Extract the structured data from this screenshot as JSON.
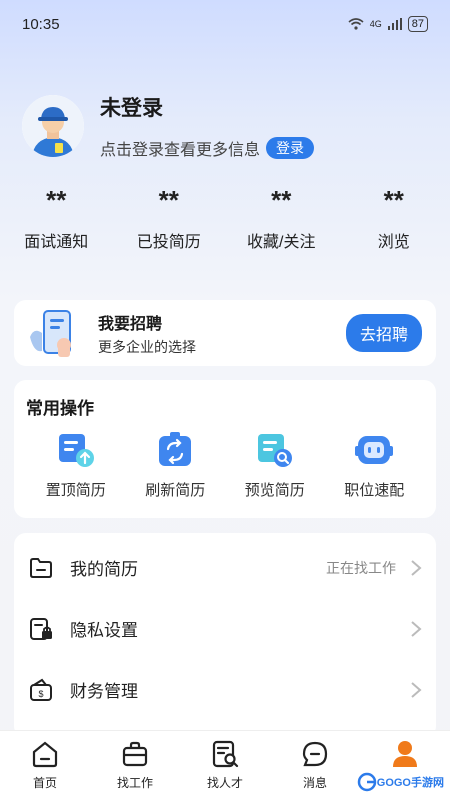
{
  "status": {
    "time": "10:35",
    "network": "4G",
    "battery": "87"
  },
  "profile": {
    "name": "未登录",
    "hint": "点击登录查看更多信息",
    "login_label": "登录"
  },
  "stats": [
    {
      "value": "**",
      "label": "面试通知"
    },
    {
      "value": "**",
      "label": "已投简历"
    },
    {
      "value": "**",
      "label": "收藏/关注"
    },
    {
      "value": "**",
      "label": "浏览"
    }
  ],
  "recruit": {
    "title": "我要招聘",
    "subtitle": "更多企业的选择",
    "button": "去招聘"
  },
  "ops": {
    "title": "常用操作",
    "items": [
      {
        "label": "置顶简历",
        "icon": "resume-top-icon"
      },
      {
        "label": "刷新简历",
        "icon": "refresh-resume-icon"
      },
      {
        "label": "预览简历",
        "icon": "preview-resume-icon"
      },
      {
        "label": "职位速配",
        "icon": "job-match-icon"
      }
    ]
  },
  "menu": [
    {
      "label": "我的简历",
      "value": "正在找工作",
      "icon": "folder-icon"
    },
    {
      "label": "隐私设置",
      "value": "",
      "icon": "privacy-lock-icon"
    },
    {
      "label": "财务管理",
      "value": "",
      "icon": "wallet-icon"
    }
  ],
  "tabs": [
    {
      "label": "首页",
      "icon": "home-icon"
    },
    {
      "label": "找工作",
      "icon": "briefcase-icon"
    },
    {
      "label": "找人才",
      "icon": "find-talent-icon"
    },
    {
      "label": "消息",
      "icon": "message-icon"
    },
    {
      "label": "",
      "icon": "user-icon",
      "active": true
    }
  ],
  "watermark": "GOGO手游网",
  "colors": {
    "accent": "#2c7bea",
    "tab_active": "#f07a1a"
  }
}
